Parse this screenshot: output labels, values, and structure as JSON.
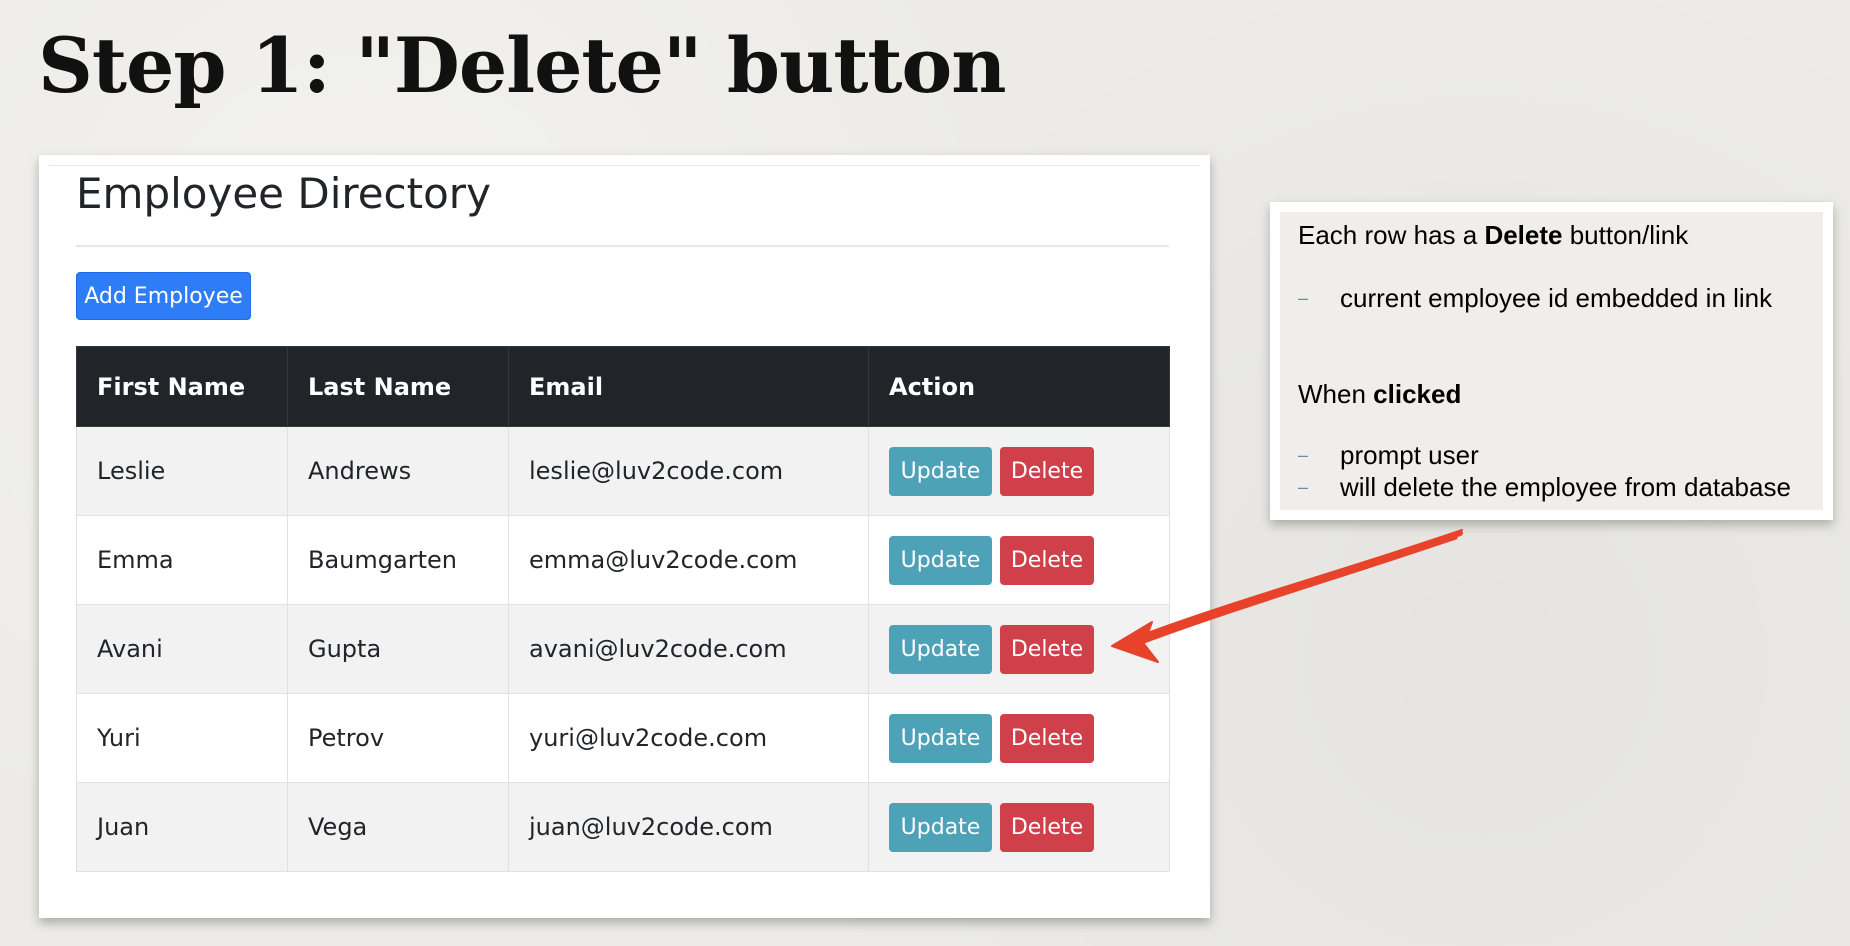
{
  "slide": {
    "title": "Step 1: \"Delete\" button"
  },
  "directory": {
    "title": "Employee Directory",
    "add_button_label": "Add Employee",
    "columns": [
      "First Name",
      "Last Name",
      "Email",
      "Action"
    ],
    "rows": [
      {
        "first": "Leslie",
        "last": "Andrews",
        "email": "leslie@luv2code.com"
      },
      {
        "first": "Emma",
        "last": "Baumgarten",
        "email": "emma@luv2code.com"
      },
      {
        "first": "Avani",
        "last": "Gupta",
        "email": "avani@luv2code.com"
      },
      {
        "first": "Yuri",
        "last": "Petrov",
        "email": "yuri@luv2code.com"
      },
      {
        "first": "Juan",
        "last": "Vega",
        "email": "juan@luv2code.com"
      }
    ],
    "update_label": "Update",
    "delete_label": "Delete"
  },
  "note": {
    "line1_prefix": "Each row has a ",
    "line1_bold": "Delete",
    "line1_suffix": " button/link",
    "dash": "–",
    "bullet1": "current employee id embedded in link",
    "line2_prefix": "When ",
    "line2_bold": "clicked",
    "bullet2": "prompt user",
    "bullet3": "will delete the employee from database"
  },
  "colors": {
    "primary": "#2f7df6",
    "info": "#4da2b8",
    "danger": "#d0404a",
    "table_header": "#212529",
    "arrow": "#e8432a"
  }
}
